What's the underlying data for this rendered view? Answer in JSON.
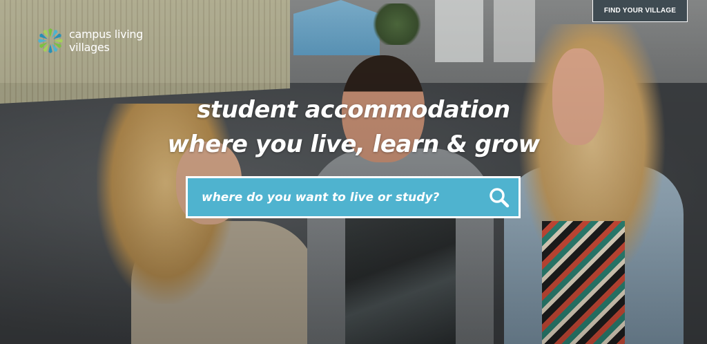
{
  "brand": {
    "logo_line1": "campus living",
    "logo_line2": "villages",
    "logo_icon": "sunburst-icon",
    "logo_colors": [
      "#7bc143",
      "#4fb3cf",
      "#2a8fb5",
      "#a6d05a"
    ]
  },
  "header": {
    "cta_label": "FIND YOUR VILLAGE"
  },
  "hero": {
    "headline_line1": "student accommodation",
    "headline_line2": "where you live, learn & grow"
  },
  "search": {
    "placeholder": "where do you want to live or study?",
    "icon": "search-icon",
    "accent_color": "#4fb3cf"
  }
}
